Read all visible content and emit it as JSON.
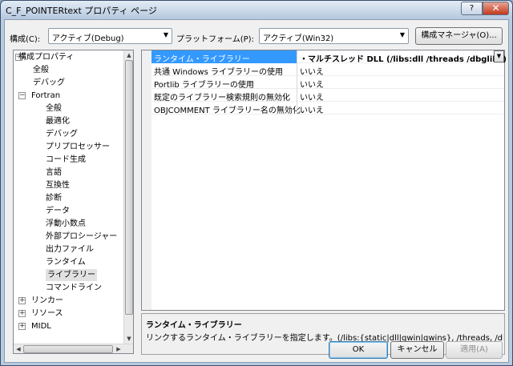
{
  "window": {
    "title": "C_F_POINTERtext プロパティ ページ",
    "help_label": "?",
    "close_label": "✕"
  },
  "toolbar": {
    "config_label": "構成(C):",
    "config_value": "アクティブ(Debug)",
    "platform_label": "プラットフォーム(P):",
    "platform_value": "アクティブ(Win32)",
    "manager_label": "構成マネージャ(O)..."
  },
  "tree": {
    "items": [
      {
        "label": "構成プロパティ",
        "expander": "−"
      },
      {
        "label": "全般"
      },
      {
        "label": "デバッグ"
      },
      {
        "label": "Fortran",
        "expander": "−"
      },
      {
        "label": "全般"
      },
      {
        "label": "最適化"
      },
      {
        "label": "デバッグ"
      },
      {
        "label": "プリプロセッサー"
      },
      {
        "label": "コード生成"
      },
      {
        "label": "言語"
      },
      {
        "label": "互換性"
      },
      {
        "label": "診断"
      },
      {
        "label": "データ"
      },
      {
        "label": "浮動小数点"
      },
      {
        "label": "外部プロシージャー"
      },
      {
        "label": "出力ファイル"
      },
      {
        "label": "ランタイム"
      },
      {
        "label": "ライブラリー",
        "selected": true
      },
      {
        "label": "コマンドライン"
      },
      {
        "label": "リンカー",
        "expander": "+"
      },
      {
        "label": "リソース",
        "expander": "+"
      },
      {
        "label": "MIDL",
        "expander": "+"
      }
    ]
  },
  "properties": {
    "rows": [
      {
        "name": "ランタイム・ライブラリー",
        "value": "・マルチスレッド DLL (/libs:dll /threads /dbglibs)",
        "selected": true
      },
      {
        "name": "共通 Windows ライブラリーの使用",
        "value": "いいえ"
      },
      {
        "name": "Portlib ライブラリーの使用",
        "value": "いいえ"
      },
      {
        "name": "既定のライブラリー検索規則の無効化",
        "value": "いいえ"
      },
      {
        "name": "OBJCOMMENT ライブラリー名の無効化",
        "value": "いいえ"
      }
    ]
  },
  "description": {
    "title": "ランタイム・ライブラリー",
    "text": "リンクするランタイム・ライブラリーを指定します。(/libs:{static|dll|qwin|qwins}, /threads, /dbg..."
  },
  "buttons": {
    "ok": "OK",
    "cancel": "キャンセル",
    "apply": "適用(A)"
  }
}
